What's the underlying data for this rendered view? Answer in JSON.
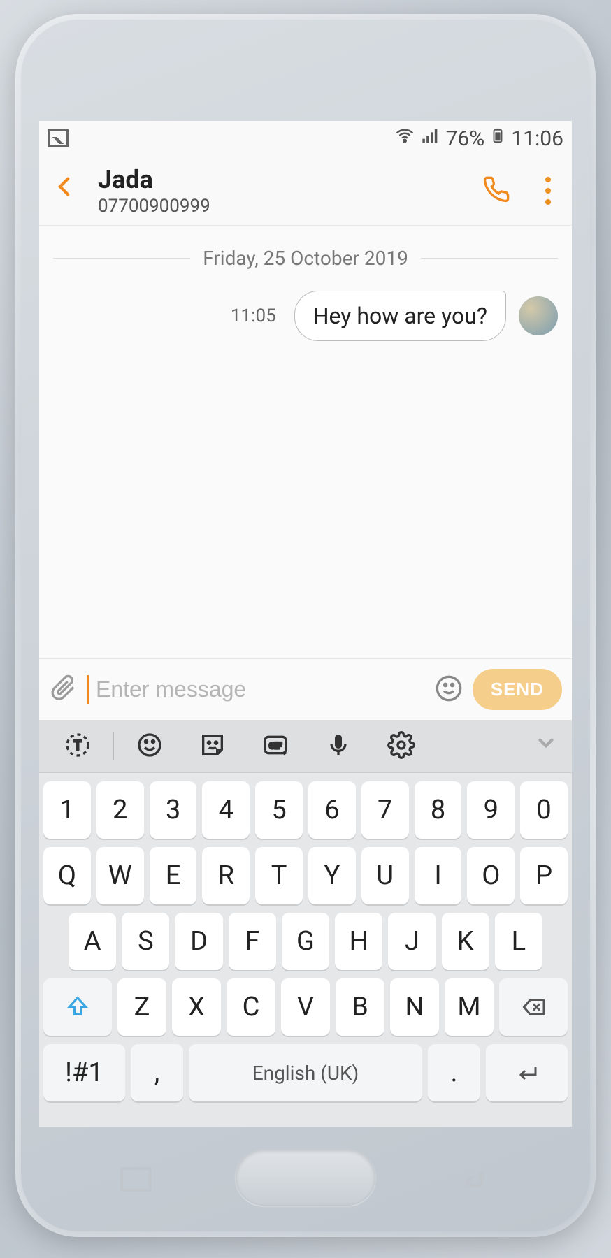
{
  "status": {
    "battery_pct": "76%",
    "clock": "11:06"
  },
  "header": {
    "contact_name": "Jada",
    "contact_number": "07700900999"
  },
  "thread": {
    "date": "Friday, 25 October 2019",
    "messages": [
      {
        "time": "11:05",
        "text": "Hey how are you?",
        "incoming": true
      }
    ]
  },
  "compose": {
    "placeholder": "Enter message",
    "send_label": "SEND"
  },
  "keyboard": {
    "rows": {
      "numbers": [
        "1",
        "2",
        "3",
        "4",
        "5",
        "6",
        "7",
        "8",
        "9",
        "0"
      ],
      "top": [
        "Q",
        "W",
        "E",
        "R",
        "T",
        "Y",
        "U",
        "I",
        "O",
        "P"
      ],
      "home": [
        "A",
        "S",
        "D",
        "F",
        "G",
        "H",
        "J",
        "K",
        "L"
      ],
      "bottom": [
        "Z",
        "X",
        "C",
        "V",
        "B",
        "N",
        "M"
      ]
    },
    "sym_label": "!#1",
    "comma": ",",
    "period": ".",
    "space_label": "English (UK)"
  }
}
